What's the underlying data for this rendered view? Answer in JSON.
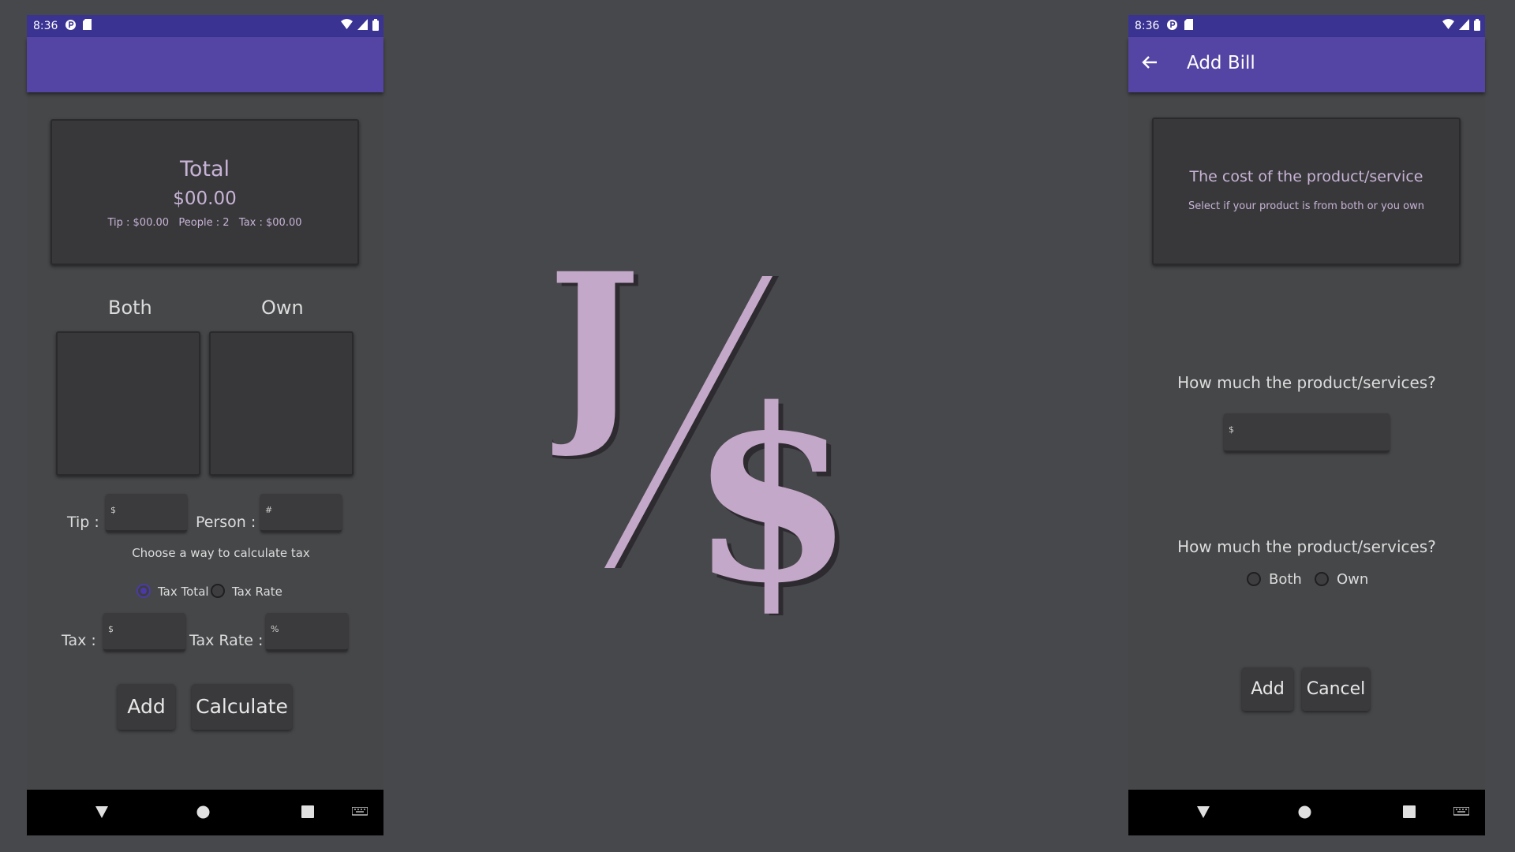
{
  "status": {
    "time": "8:36",
    "icons_left": [
      "p-icon",
      "sd-card-icon"
    ],
    "icons_right": [
      "wifi-icon",
      "signal-icon",
      "battery-icon"
    ]
  },
  "left_screen": {
    "total_card": {
      "title": "Total",
      "amount": "$00.00",
      "details": "Tip : $00.00   People : 2   Tax : $00.00"
    },
    "columns": {
      "both": "Both",
      "own": "Own"
    },
    "tip_label": "Tip :",
    "tip_placeholder": "$",
    "person_label": "Person :",
    "person_placeholder": "#",
    "choose_tax_text": "Choose a way to calculate tax",
    "radio_tax_total": "Tax Total",
    "radio_tax_rate": "Tax Rate",
    "tax_label": "Tax :",
    "tax_placeholder": "$",
    "tax_rate_label": "Tax Rate :",
    "tax_rate_placeholder": "%",
    "add_button": "Add",
    "calculate_button": "Calculate"
  },
  "right_screen": {
    "app_bar_title": "Add Bill",
    "info_card": {
      "title": "The cost of the product/service",
      "subtitle": "Select if your product is from both or you own"
    },
    "question_1": "How much the product/services?",
    "price_placeholder": "$",
    "question_2": "How much the product/services?",
    "radio_both": "Both",
    "radio_own": "Own",
    "add_button": "Add",
    "cancel_button": "Cancel"
  },
  "logo": {
    "letter": "J",
    "symbol": "$",
    "color": "#c4a8c9"
  },
  "colors": {
    "background": "#47484b",
    "status_bar": "#3a3392",
    "app_bar": "#5445a4",
    "accent_text": "#c7b3d6"
  }
}
